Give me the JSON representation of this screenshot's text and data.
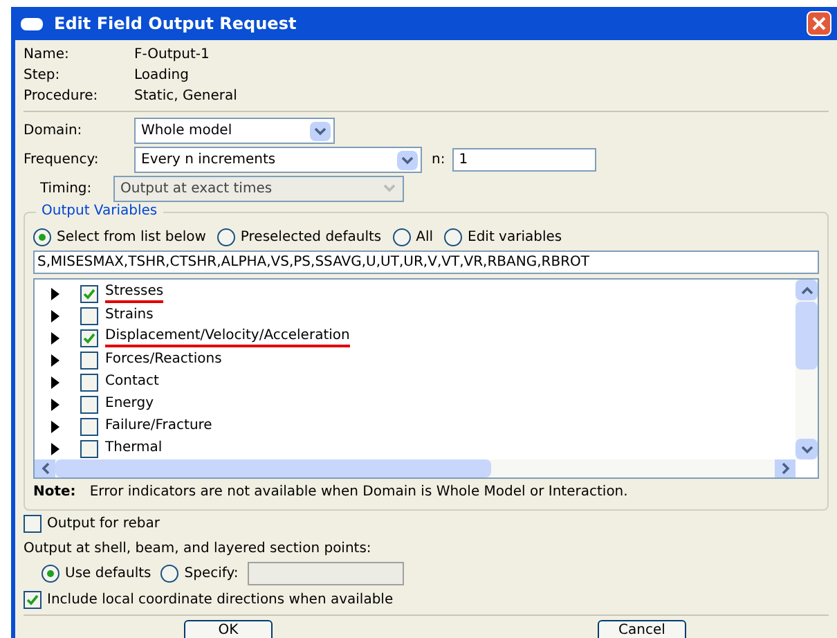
{
  "window": {
    "title": "Edit Field Output Request"
  },
  "info": [
    {
      "label": "Name:",
      "value": "F-Output-1"
    },
    {
      "label": "Step:",
      "value": "Loading"
    },
    {
      "label": "Procedure:",
      "value": "Static, General"
    }
  ],
  "domain": {
    "label": "Domain:",
    "value": "Whole model"
  },
  "frequency": {
    "label": "Frequency:",
    "value": "Every n increments",
    "n_label": "n:",
    "n_value": "1"
  },
  "timing": {
    "label": "Timing:",
    "value": "Output at exact times",
    "disabled": true
  },
  "output_variables": {
    "title": "Output Variables",
    "options": [
      {
        "label": "Select from list below",
        "selected": true
      },
      {
        "label": "Preselected defaults",
        "selected": false
      },
      {
        "label": "All",
        "selected": false
      },
      {
        "label": "Edit variables",
        "selected": false
      }
    ],
    "variables_text": "S,MISESMAX,TSHR,CTSHR,ALPHA,VS,PS,SSAVG,U,UT,UR,V,VT,VR,RBANG,RBROT",
    "tree": [
      {
        "label": "Stresses",
        "checked": true,
        "highlighted": true
      },
      {
        "label": "Strains",
        "checked": false,
        "highlighted": false
      },
      {
        "label": "Displacement/Velocity/Acceleration",
        "checked": true,
        "highlighted": true
      },
      {
        "label": "Forces/Reactions",
        "checked": false,
        "highlighted": false
      },
      {
        "label": "Contact",
        "checked": false,
        "highlighted": false
      },
      {
        "label": "Energy",
        "checked": false,
        "highlighted": false
      },
      {
        "label": "Failure/Fracture",
        "checked": false,
        "highlighted": false
      },
      {
        "label": "Thermal",
        "checked": false,
        "highlighted": false
      }
    ],
    "note_label": "Note:",
    "note": "Error indicators are not available when Domain is Whole Model or Interaction."
  },
  "rebar": {
    "label": "Output for rebar",
    "checked": false
  },
  "section_points": {
    "label": "Output at shell, beam, and layered section points:",
    "options": [
      {
        "label": "Use defaults",
        "selected": true
      },
      {
        "label": "Specify:",
        "selected": false
      }
    ]
  },
  "local_coords": {
    "label": "Include local coordinate directions when available",
    "checked": true
  },
  "buttons": [
    "OK",
    "Cancel"
  ]
}
